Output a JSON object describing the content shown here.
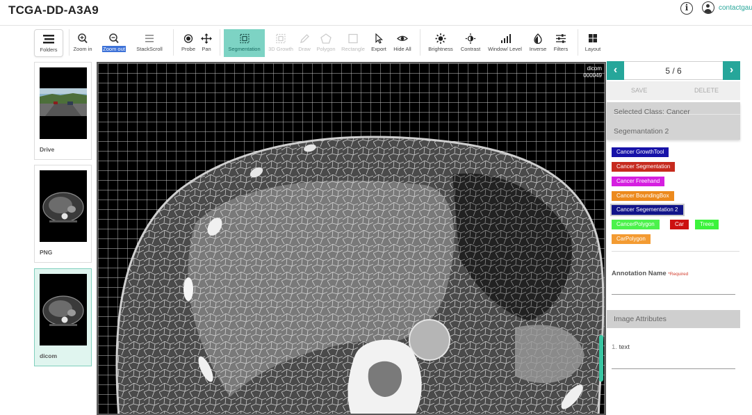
{
  "header": {
    "title": "TCGA-DD-A3A9",
    "info_symbol": "i",
    "user_name": "contactgau"
  },
  "toolbar": {
    "tools": [
      {
        "label": "Folders",
        "icon": "folders-icon"
      },
      {
        "label": "Zoom in",
        "icon": "zoom-in-icon"
      },
      {
        "label": "Zoom out",
        "icon": "zoom-out-icon"
      },
      {
        "label": "StackScroll",
        "icon": "stack-scroll-icon"
      },
      {
        "label": "Probe",
        "icon": "probe-icon"
      },
      {
        "label": "Pan",
        "icon": "pan-icon"
      },
      {
        "label": "Segmentation",
        "icon": "segmentation-icon"
      },
      {
        "label": "3D Growth",
        "icon": "growth-3d-icon"
      },
      {
        "label": "Draw",
        "icon": "draw-icon"
      },
      {
        "label": "Polygon",
        "icon": "polygon-icon"
      },
      {
        "label": "Rectangle",
        "icon": "rectangle-icon"
      },
      {
        "label": "Export",
        "icon": "export-icon"
      },
      {
        "label": "Hide All",
        "icon": "hide-all-icon"
      },
      {
        "label": "Brightness",
        "icon": "brightness-icon"
      },
      {
        "label": "Contrast",
        "icon": "contrast-icon"
      },
      {
        "label": "Window/ Level",
        "icon": "window-level-icon"
      },
      {
        "label": "Inverse",
        "icon": "inverse-icon"
      },
      {
        "label": "Filters",
        "icon": "filters-icon"
      },
      {
        "label": "Layout",
        "icon": "layout-icon"
      }
    ]
  },
  "thumbnails": [
    {
      "label": "Drive"
    },
    {
      "label": "PNG"
    },
    {
      "label": "dicom"
    }
  ],
  "viewer": {
    "label": "dicom",
    "frame": "000049"
  },
  "pager": {
    "text": "5 / 6",
    "prev": "‹",
    "next": "›"
  },
  "actions": {
    "save": "SAVE",
    "delete": "DELETE"
  },
  "selected": {
    "class_label": "Selected Class: Cancer",
    "segmentation_label": "Segemantation 2"
  },
  "classes": [
    {
      "label": "Cancer GrowthTool",
      "color": "#1712a8"
    },
    {
      "label": "Cancer Segmentation",
      "color": "#c62a1e"
    },
    {
      "label": "Cancer Freehand",
      "color": "#d51fe0"
    },
    {
      "label": "Cancer BoundingBox",
      "color": "#ec8a1d"
    },
    {
      "label": "Cancer Segementation 2",
      "color": "#111489"
    },
    {
      "label": "CancerPolygon",
      "color": "#4cf24c"
    },
    {
      "label": "Car",
      "color": "#cc1010"
    },
    {
      "label": "Trees",
      "color": "#3cf33c"
    },
    {
      "label": "CarPolygon",
      "color": "#f39b32"
    }
  ],
  "annotation": {
    "label": "Annotation Name",
    "required": "*Required"
  },
  "attributes": {
    "header": "Image Attributes",
    "items": [
      {
        "num": "1.",
        "text": "text"
      }
    ]
  }
}
